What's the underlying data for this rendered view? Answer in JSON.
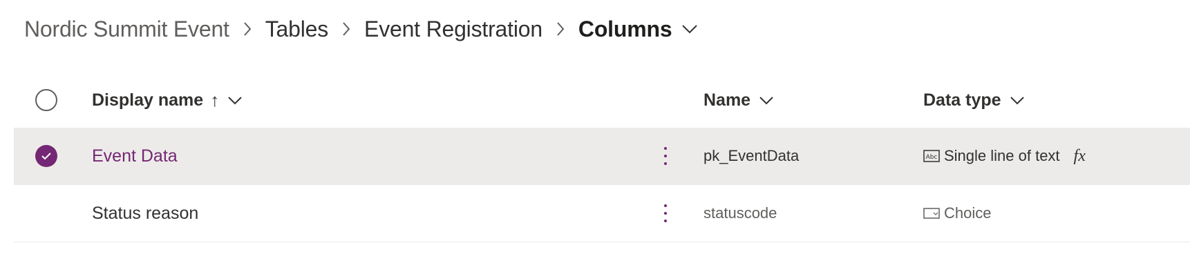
{
  "breadcrumb": {
    "items": [
      "Nordic Summit Event",
      "Tables",
      "Event Registration",
      "Columns"
    ]
  },
  "table": {
    "columns": {
      "display_name": "Display name",
      "display_name_sort": "↑",
      "name": "Name",
      "data_type": "Data type"
    },
    "rows": [
      {
        "display_name": "Event Data",
        "name": "pk_EventData",
        "data_type": "Single line of text",
        "type_icon": "text-field-icon",
        "has_formula": true,
        "formula_label": "fx",
        "selected": true
      },
      {
        "display_name": "Status reason",
        "name": "statuscode",
        "data_type": "Choice",
        "type_icon": "choice-icon",
        "has_formula": false,
        "selected": false
      }
    ]
  },
  "colors": {
    "accent": "#742774",
    "selected_row": "#edebe9",
    "text": "#323130",
    "muted": "#605e5c"
  }
}
